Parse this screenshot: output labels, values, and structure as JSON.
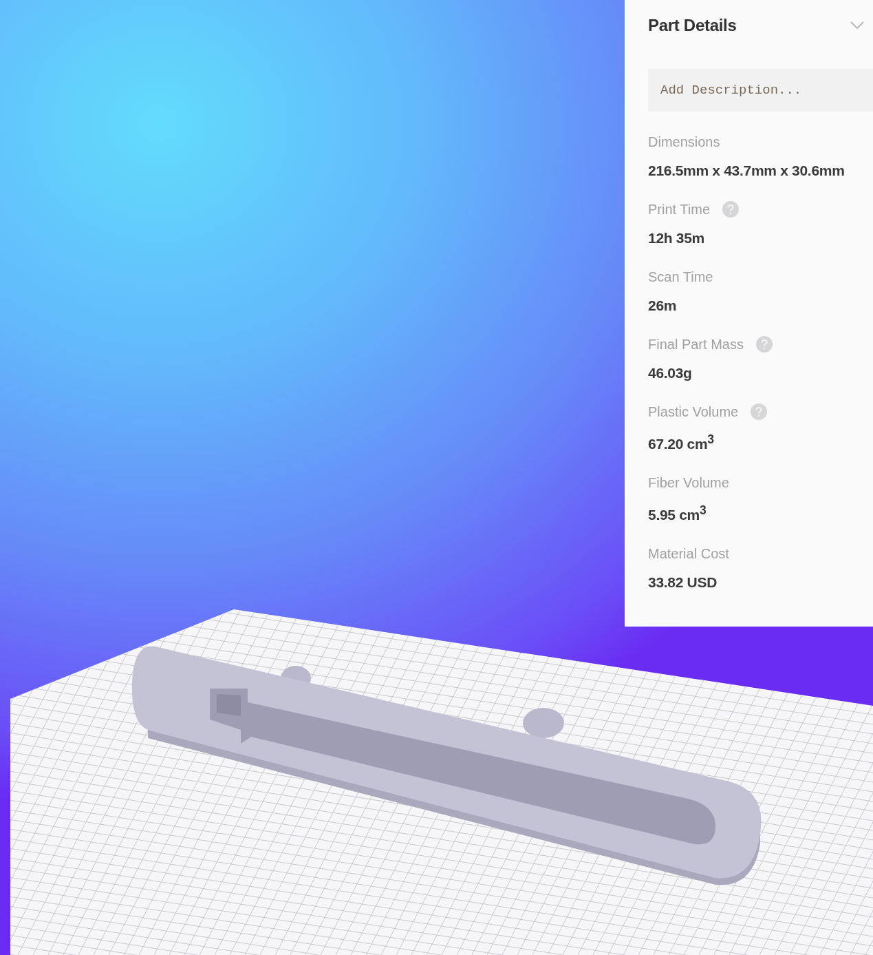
{
  "panel": {
    "title": "Part Details",
    "expanded": true,
    "description": {
      "placeholder": "Add Description..."
    },
    "fields": [
      {
        "label": "Dimensions",
        "help": false,
        "value": "216.5mm x 43.7mm x 30.6mm"
      },
      {
        "label": "Print Time",
        "help": true,
        "value": "12h 35m"
      },
      {
        "label": "Scan Time",
        "help": false,
        "value": "26m"
      },
      {
        "label": "Final Part Mass",
        "help": true,
        "value": "46.03g"
      },
      {
        "label": "Plastic Volume",
        "help": true,
        "value": "67.20 cm$^{3}$"
      },
      {
        "label": "Fiber Volume",
        "help": false,
        "value": "5.95 cm$^{3}$"
      },
      {
        "label": "Material Cost",
        "help": false,
        "value": "33.82 USD"
      }
    ]
  }
}
